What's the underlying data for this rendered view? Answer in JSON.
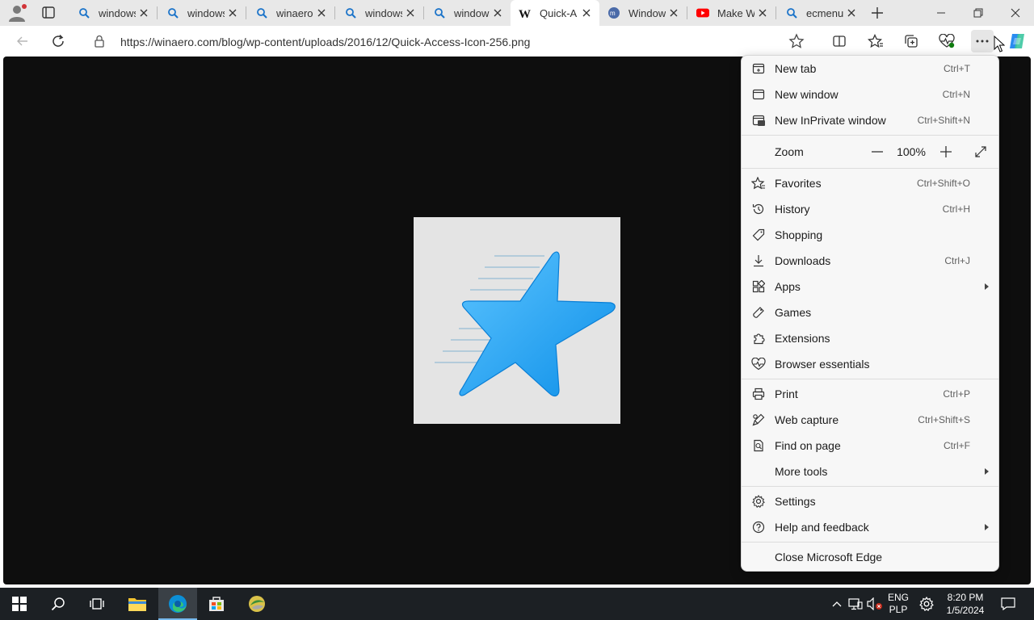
{
  "tabs": [
    {
      "label": "windows",
      "icon": "search-icon"
    },
    {
      "label": "windows",
      "icon": "search-icon"
    },
    {
      "label": "winaero",
      "icon": "search-icon"
    },
    {
      "label": "windows",
      "icon": "search-icon"
    },
    {
      "label": "windows",
      "icon": "search-icon"
    },
    {
      "label": "Quick-A",
      "icon": "winaero-favicon"
    },
    {
      "label": "Window",
      "icon": "site-favicon"
    },
    {
      "label": "Make W",
      "icon": "youtube-favicon"
    },
    {
      "label": "ecmenu",
      "icon": "search-icon"
    }
  ],
  "address_bar": {
    "url": "https://winaero.com/blog/wp-content/uploads/2016/12/Quick-Access-Icon-256.png"
  },
  "menu": {
    "items": [
      {
        "label": "New tab",
        "shortcut": "Ctrl+T",
        "icon": "new-tab-icon"
      },
      {
        "label": "New window",
        "shortcut": "Ctrl+N",
        "icon": "new-window-icon"
      },
      {
        "label": "New InPrivate window",
        "shortcut": "Ctrl+Shift+N",
        "icon": "inprivate-icon"
      },
      {
        "label": "Favorites",
        "shortcut": "Ctrl+Shift+O",
        "icon": "favorites-icon"
      },
      {
        "label": "History",
        "shortcut": "Ctrl+H",
        "icon": "history-icon"
      },
      {
        "label": "Shopping",
        "shortcut": "",
        "icon": "shopping-tag-icon"
      },
      {
        "label": "Downloads",
        "shortcut": "Ctrl+J",
        "icon": "download-icon"
      },
      {
        "label": "Apps",
        "shortcut": "",
        "icon": "apps-icon"
      },
      {
        "label": "Games",
        "shortcut": "",
        "icon": "games-icon"
      },
      {
        "label": "Extensions",
        "shortcut": "",
        "icon": "extensions-icon"
      },
      {
        "label": "Browser essentials",
        "shortcut": "",
        "icon": "heartbeat-icon"
      },
      {
        "label": "Print",
        "shortcut": "Ctrl+P",
        "icon": "print-icon"
      },
      {
        "label": "Web capture",
        "shortcut": "Ctrl+Shift+S",
        "icon": "web-capture-icon"
      },
      {
        "label": "Find on page",
        "shortcut": "Ctrl+F",
        "icon": "find-icon"
      },
      {
        "label": "More tools",
        "shortcut": "",
        "icon": ""
      },
      {
        "label": "Settings",
        "shortcut": "",
        "icon": "settings-icon"
      },
      {
        "label": "Help and feedback",
        "shortcut": "",
        "icon": "help-icon"
      },
      {
        "label": "Close Microsoft Edge",
        "shortcut": "",
        "icon": ""
      }
    ],
    "zoom": {
      "label": "Zoom",
      "value": "100%"
    }
  },
  "taskbar": {
    "lang_top": "ENG",
    "lang_bottom": "PLP",
    "time": "8:20 PM",
    "date": "1/5/2024"
  },
  "colors": {
    "star_blue": "#1aa3f0",
    "viewport_bg": "#0e0e0e",
    "taskbar_bg": "#1c2024"
  }
}
